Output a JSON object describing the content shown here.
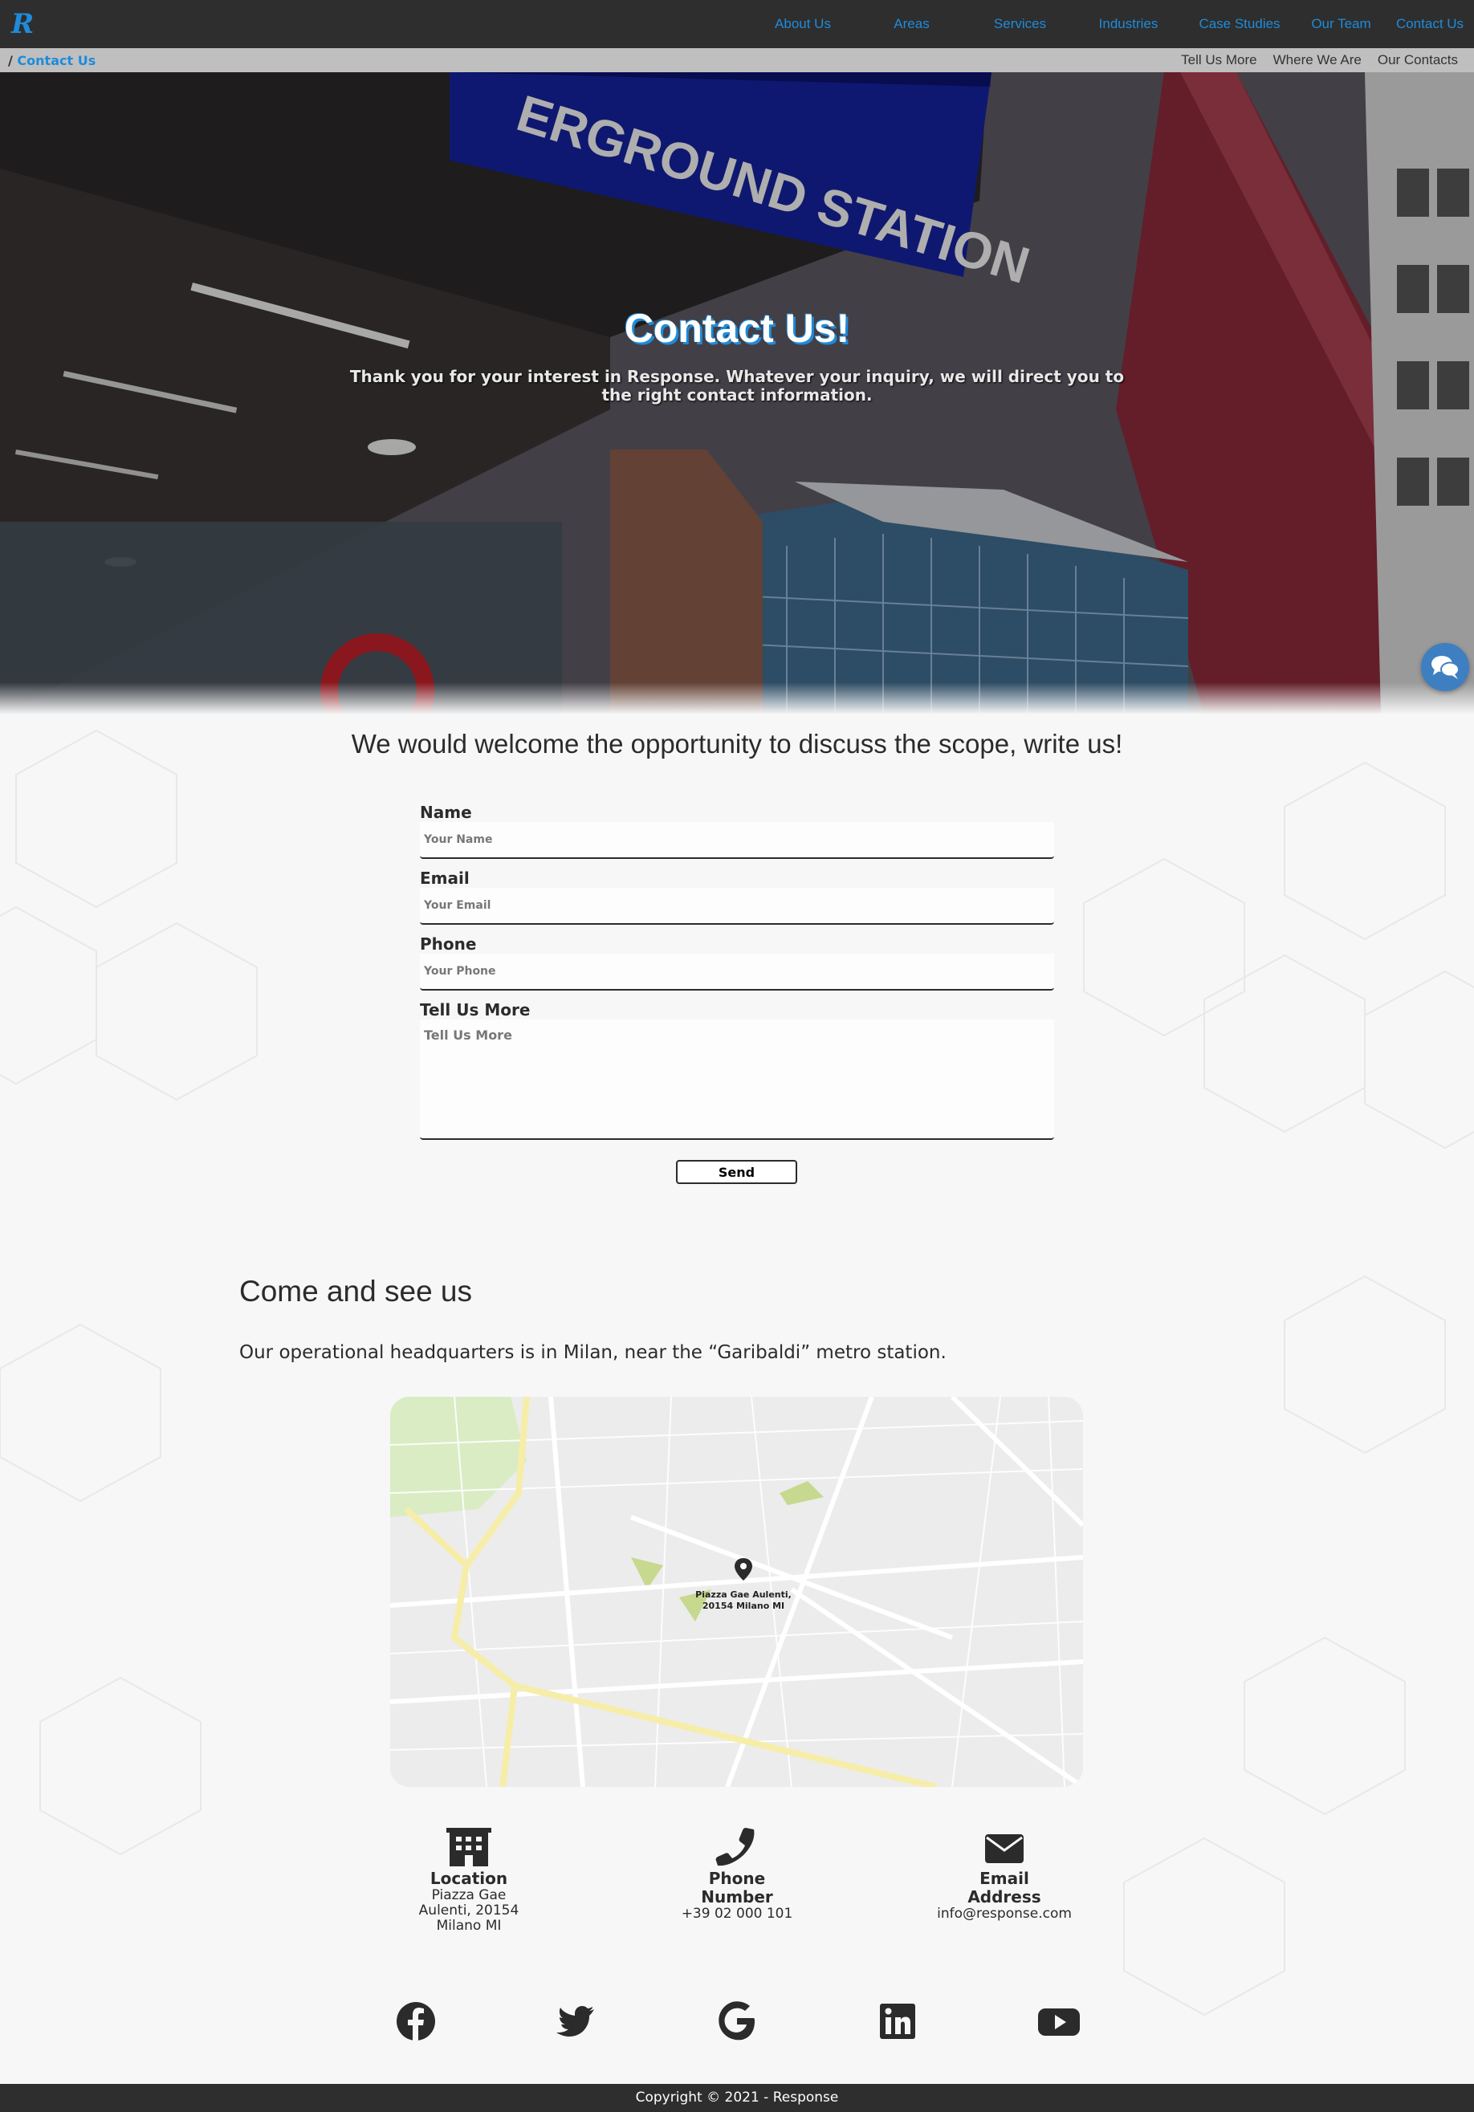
{
  "nav": {
    "logo_letter": "R",
    "links": [
      "About Us",
      "Areas",
      "Services",
      "Industries",
      "Case Studies",
      "Our Team",
      "Contact Us"
    ]
  },
  "breadcrumb": {
    "separator": "/",
    "current": "Contact Us"
  },
  "subnav": [
    "Tell Us More",
    "Where We Are",
    "Our Contacts"
  ],
  "hero": {
    "sign_text": "ERGROUND STATION",
    "title": "Contact Us!",
    "subtitle": "Thank you for your interest in Response. Whatever your inquiry, we will direct you to the right contact information."
  },
  "form": {
    "heading": "We would welcome the opportunity to discuss the scope, write us!",
    "name_label": "Name",
    "name_placeholder": "Your Name",
    "email_label": "Email",
    "email_placeholder": "Your Email",
    "phone_label": "Phone",
    "phone_placeholder": "Your Phone",
    "more_label": "Tell Us More",
    "more_placeholder": "Tell Us More",
    "send_label": "Send"
  },
  "visit": {
    "title": "Come and see us",
    "text": "Our operational headquarters is in Milan, near the “Garibaldi” metro station.",
    "map_pin_line1": "Piazza Gae Aulenti,",
    "map_pin_line2": "20154 Milano MI"
  },
  "contacts": {
    "location_title": "Location",
    "location_value": "Piazza Gae Aulenti, 20154 Milano MI",
    "phone_title": "Phone Number",
    "phone_value": "+39 02 000 101",
    "email_title": "Email Address",
    "email_value": "info@response.com"
  },
  "social": [
    "facebook-icon",
    "twitter-icon",
    "google-icon",
    "linkedin-icon",
    "youtube-icon"
  ],
  "footer": {
    "copyright": "Copyright © 2021 - Response"
  },
  "colors": {
    "accent": "#1f8bd9",
    "nav_bg": "#2e2e2e",
    "chat": "#3e7fc2"
  }
}
